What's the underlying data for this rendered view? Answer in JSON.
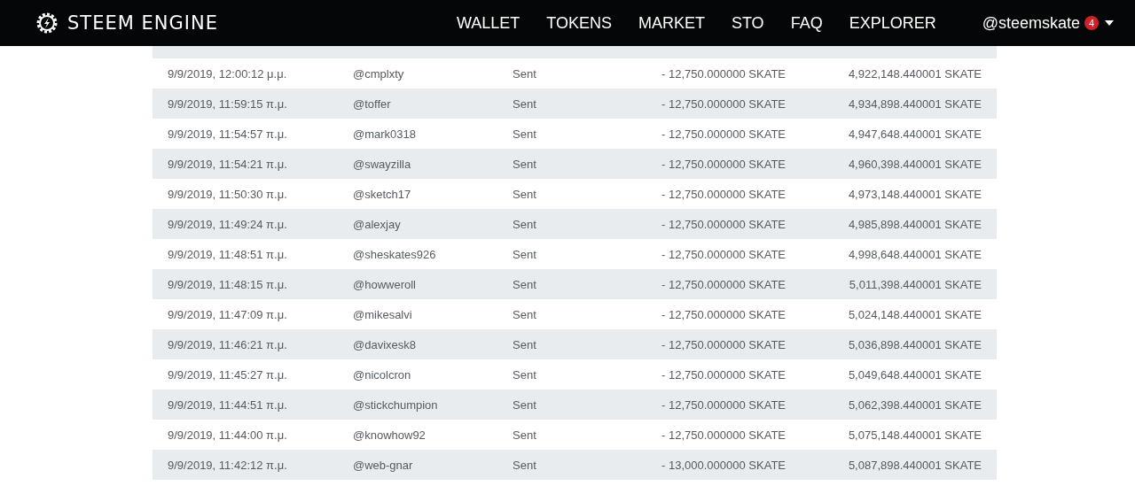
{
  "header": {
    "brand": "STEEM ENGINE",
    "nav": [
      {
        "label": "WALLET"
      },
      {
        "label": "TOKENS"
      },
      {
        "label": "MARKET"
      },
      {
        "label": "STO"
      },
      {
        "label": "FAQ"
      },
      {
        "label": "EXPLORER"
      }
    ],
    "account": {
      "username": "@steemskate",
      "notifications": "4"
    }
  },
  "table": {
    "rows": [
      {
        "date": "9/9/2019, 12:00:12 μ.μ.",
        "account": "@cmplxty",
        "type": "Sent",
        "amount": "- 12,750.000000 SKATE",
        "balance": "4,922,148.440001 SKATE"
      },
      {
        "date": "9/9/2019, 11:59:15 π.μ.",
        "account": "@toffer",
        "type": "Sent",
        "amount": "- 12,750.000000 SKATE",
        "balance": "4,934,898.440001 SKATE"
      },
      {
        "date": "9/9/2019, 11:54:57 π.μ.",
        "account": "@mark0318",
        "type": "Sent",
        "amount": "- 12,750.000000 SKATE",
        "balance": "4,947,648.440001 SKATE"
      },
      {
        "date": "9/9/2019, 11:54:21 π.μ.",
        "account": "@swayzilla",
        "type": "Sent",
        "amount": "- 12,750.000000 SKATE",
        "balance": "4,960,398.440001 SKATE"
      },
      {
        "date": "9/9/2019, 11:50:30 π.μ.",
        "account": "@sketch17",
        "type": "Sent",
        "amount": "- 12,750.000000 SKATE",
        "balance": "4,973,148.440001 SKATE"
      },
      {
        "date": "9/9/2019, 11:49:24 π.μ.",
        "account": "@alexjay",
        "type": "Sent",
        "amount": "- 12,750.000000 SKATE",
        "balance": "4,985,898.440001 SKATE"
      },
      {
        "date": "9/9/2019, 11:48:51 π.μ.",
        "account": "@sheskates926",
        "type": "Sent",
        "amount": "- 12,750.000000 SKATE",
        "balance": "4,998,648.440001 SKATE"
      },
      {
        "date": "9/9/2019, 11:48:15 π.μ.",
        "account": "@howweroll",
        "type": "Sent",
        "amount": "- 12,750.000000 SKATE",
        "balance": "5,011,398.440001 SKATE"
      },
      {
        "date": "9/9/2019, 11:47:09 π.μ.",
        "account": "@mikesalvi",
        "type": "Sent",
        "amount": "- 12,750.000000 SKATE",
        "balance": "5,024,148.440001 SKATE"
      },
      {
        "date": "9/9/2019, 11:46:21 π.μ.",
        "account": "@davixesk8",
        "type": "Sent",
        "amount": "- 12,750.000000 SKATE",
        "balance": "5,036,898.440001 SKATE"
      },
      {
        "date": "9/9/2019, 11:45:27 π.μ.",
        "account": "@nicolcron",
        "type": "Sent",
        "amount": "- 12,750.000000 SKATE",
        "balance": "5,049,648.440001 SKATE"
      },
      {
        "date": "9/9/2019, 11:44:51 π.μ.",
        "account": "@stickchumpion",
        "type": "Sent",
        "amount": "- 12,750.000000 SKATE",
        "balance": "5,062,398.440001 SKATE"
      },
      {
        "date": "9/9/2019, 11:44:00 π.μ.",
        "account": "@knowhow92",
        "type": "Sent",
        "amount": "- 12,750.000000 SKATE",
        "balance": "5,075,148.440001 SKATE"
      },
      {
        "date": "9/9/2019, 11:42:12 π.μ.",
        "account": "@web-gnar",
        "type": "Sent",
        "amount": "- 13,000.000000 SKATE",
        "balance": "5,087,898.440001 SKATE"
      }
    ]
  }
}
